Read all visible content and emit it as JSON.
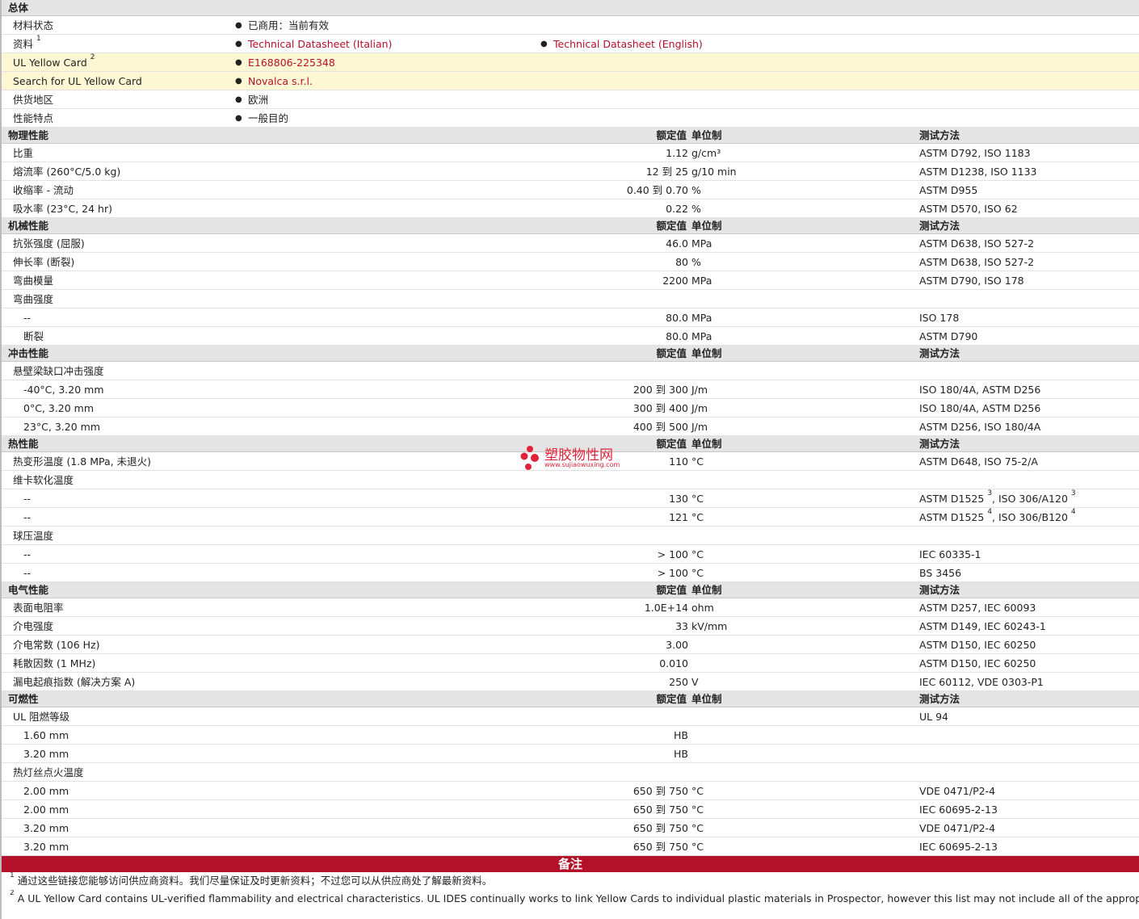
{
  "general": {
    "header": "总体",
    "rows": [
      {
        "label": "材料状态",
        "sup": "",
        "values": [
          {
            "text": "已商用：当前有效",
            "link": false
          }
        ],
        "highlight": false
      },
      {
        "label": "资料",
        "sup": "1",
        "values": [
          {
            "text": "Technical Datasheet (Italian)",
            "link": true
          },
          {
            "text": "Technical Datasheet (English)",
            "link": true
          }
        ],
        "highlight": false
      },
      {
        "label": "UL Yellow Card",
        "sup": "2",
        "values": [
          {
            "text": "E168806-225348",
            "link": true
          }
        ],
        "highlight": true
      },
      {
        "label": "Search for UL Yellow Card",
        "sup": "",
        "values": [
          {
            "text": "Novalca s.r.l.",
            "link": true
          }
        ],
        "highlight": true
      },
      {
        "label": "供货地区",
        "sup": "",
        "values": [
          {
            "text": "欧洲",
            "link": false
          }
        ],
        "highlight": false
      },
      {
        "label": "性能特点",
        "sup": "",
        "values": [
          {
            "text": "一般目的",
            "link": false
          }
        ],
        "highlight": false
      }
    ]
  },
  "column_headers": {
    "value": "额定值",
    "unit": "单位制",
    "method": "测试方法"
  },
  "sections": [
    {
      "title": "物理性能",
      "rows": [
        {
          "label": "比重",
          "value": "1.12",
          "unit": "g/cm³",
          "method": [
            {
              "t": "ASTM D792, ISO 1183"
            }
          ]
        },
        {
          "label": "熔流率 (260°C/5.0 kg)",
          "value": "12 到  25",
          "unit": "g/10 min",
          "method": [
            {
              "t": "ASTM D1238, ISO 1133"
            }
          ]
        },
        {
          "label": "收缩率 - 流动",
          "value": "0.40 到  0.70",
          "unit": "%",
          "method": [
            {
              "t": "ASTM D955"
            }
          ]
        },
        {
          "label": "吸水率 (23°C, 24 hr)",
          "value": "0.22",
          "unit": "%",
          "method": [
            {
              "t": "ASTM D570, ISO 62"
            }
          ]
        }
      ]
    },
    {
      "title": "机械性能",
      "rows": [
        {
          "label": "抗张强度 (屈服)",
          "value": "46.0",
          "unit": "MPa",
          "method": [
            {
              "t": "ASTM D638, ISO 527-2"
            }
          ]
        },
        {
          "label": "伸长率 (断裂)",
          "value": "80",
          "unit": "%",
          "method": [
            {
              "t": "ASTM D638, ISO 527-2"
            }
          ]
        },
        {
          "label": "弯曲模量",
          "value": "2200",
          "unit": "MPa",
          "method": [
            {
              "t": "ASTM D790, ISO 178"
            }
          ]
        },
        {
          "label": "弯曲强度",
          "value": "",
          "unit": "",
          "method": []
        },
        {
          "label": "--",
          "indent": true,
          "value": "80.0",
          "unit": "MPa",
          "method": [
            {
              "t": "ISO 178"
            }
          ]
        },
        {
          "label": "断裂",
          "indent": true,
          "value": "80.0",
          "unit": "MPa",
          "method": [
            {
              "t": "ASTM D790"
            }
          ]
        }
      ]
    },
    {
      "title": "冲击性能",
      "rows": [
        {
          "label": "悬壁梁缺口冲击强度",
          "value": "",
          "unit": "",
          "method": []
        },
        {
          "label": "-40°C, 3.20 mm",
          "indent": true,
          "value": "200 到  300",
          "unit": "J/m",
          "method": [
            {
              "t": "ISO 180/4A, ASTM D256"
            }
          ]
        },
        {
          "label": "0°C, 3.20 mm",
          "indent": true,
          "value": "300 到  400",
          "unit": "J/m",
          "method": [
            {
              "t": "ISO 180/4A, ASTM D256"
            }
          ]
        },
        {
          "label": "23°C, 3.20 mm",
          "indent": true,
          "value": "400 到  500",
          "unit": "J/m",
          "method": [
            {
              "t": "ASTM D256, ISO 180/4A"
            }
          ]
        }
      ]
    },
    {
      "title": "热性能",
      "rows": [
        {
          "label": "热变形温度 (1.8 MPa, 未退火)",
          "value": "110",
          "unit": "°C",
          "method": [
            {
              "t": "ASTM D648, ISO 75-2/A"
            }
          ]
        },
        {
          "label": "维卡软化温度",
          "value": "",
          "unit": "",
          "method": []
        },
        {
          "label": "--",
          "indent": true,
          "value": "130",
          "unit": "°C",
          "method": [
            {
              "t": "ASTM D1525",
              "s": "3"
            },
            {
              "t": ", ISO 306/A120",
              "s": "3"
            }
          ]
        },
        {
          "label": "--",
          "indent": true,
          "value": "121",
          "unit": "°C",
          "method": [
            {
              "t": "ASTM D1525",
              "s": "4"
            },
            {
              "t": ", ISO 306/B120",
              "s": "4"
            }
          ]
        },
        {
          "label": "球压温度",
          "value": "",
          "unit": "",
          "method": []
        },
        {
          "label": "--",
          "indent": true,
          "value": "> 100",
          "unit": "°C",
          "method": [
            {
              "t": "IEC 60335-1"
            }
          ]
        },
        {
          "label": "--",
          "indent": true,
          "value": "> 100",
          "unit": "°C",
          "method": [
            {
              "t": "BS 3456"
            }
          ]
        }
      ]
    },
    {
      "title": "电气性能",
      "rows": [
        {
          "label": "表面电阻率",
          "value": "1.0E+14",
          "unit": "ohm",
          "method": [
            {
              "t": "ASTM D257, IEC 60093"
            }
          ]
        },
        {
          "label": "介电强度",
          "value": "33",
          "unit": "kV/mm",
          "method": [
            {
              "t": "ASTM D149, IEC 60243-1"
            }
          ]
        },
        {
          "label": "介电常数 (106 Hz)",
          "value": "3.00",
          "unit": "",
          "method": [
            {
              "t": "ASTM D150, IEC 60250"
            }
          ]
        },
        {
          "label": "耗散因数 (1 MHz)",
          "value": "0.010",
          "unit": "",
          "method": [
            {
              "t": "ASTM D150, IEC 60250"
            }
          ]
        },
        {
          "label": "漏电起痕指数 (解决方案 A)",
          "value": "250",
          "unit": "V",
          "method": [
            {
              "t": "IEC 60112, VDE 0303-P1"
            }
          ]
        }
      ]
    },
    {
      "title": "可燃性",
      "rows": [
        {
          "label": "UL 阻燃等级",
          "value": "",
          "unit": "",
          "method": [
            {
              "t": "UL 94"
            }
          ]
        },
        {
          "label": "1.60 mm",
          "indent": true,
          "value": "HB",
          "unit": "",
          "method": []
        },
        {
          "label": "3.20 mm",
          "indent": true,
          "value": "HB",
          "unit": "",
          "method": []
        },
        {
          "label": "热灯丝点火温度",
          "value": "",
          "unit": "",
          "method": []
        },
        {
          "label": "2.00 mm",
          "indent": true,
          "value": "650 到  750",
          "unit": "°C",
          "method": [
            {
              "t": "VDE 0471/P2-4"
            }
          ]
        },
        {
          "label": "2.00 mm",
          "indent": true,
          "value": "650 到  750",
          "unit": "°C",
          "method": [
            {
              "t": "IEC 60695-2-13"
            }
          ]
        },
        {
          "label": "3.20 mm",
          "indent": true,
          "value": "650 到  750",
          "unit": "°C",
          "method": [
            {
              "t": "VDE 0471/P2-4"
            }
          ]
        },
        {
          "label": "3.20 mm",
          "indent": true,
          "value": "650 到  750",
          "unit": "°C",
          "method": [
            {
              "t": "IEC 60695-2-13"
            }
          ]
        }
      ]
    }
  ],
  "notes": {
    "title": "备注",
    "items": [
      {
        "num": "1",
        "text": "通过这些链接您能够访问供应商资料。我们尽量保证及时更新资料；不过您可以从供应商处了解最新资料。"
      },
      {
        "num": "2",
        "text": "A UL Yellow Card contains UL-verified flammability and electrical characteristics. UL IDES continually works to link Yellow Cards to individual plastic materials in Prospector, however this list may not include all of the appropriate links. It is"
      }
    ]
  },
  "watermark": {
    "title": "塑胶物性网",
    "site": "www.sujiaowuxing.com",
    "color": "#e0233b"
  }
}
